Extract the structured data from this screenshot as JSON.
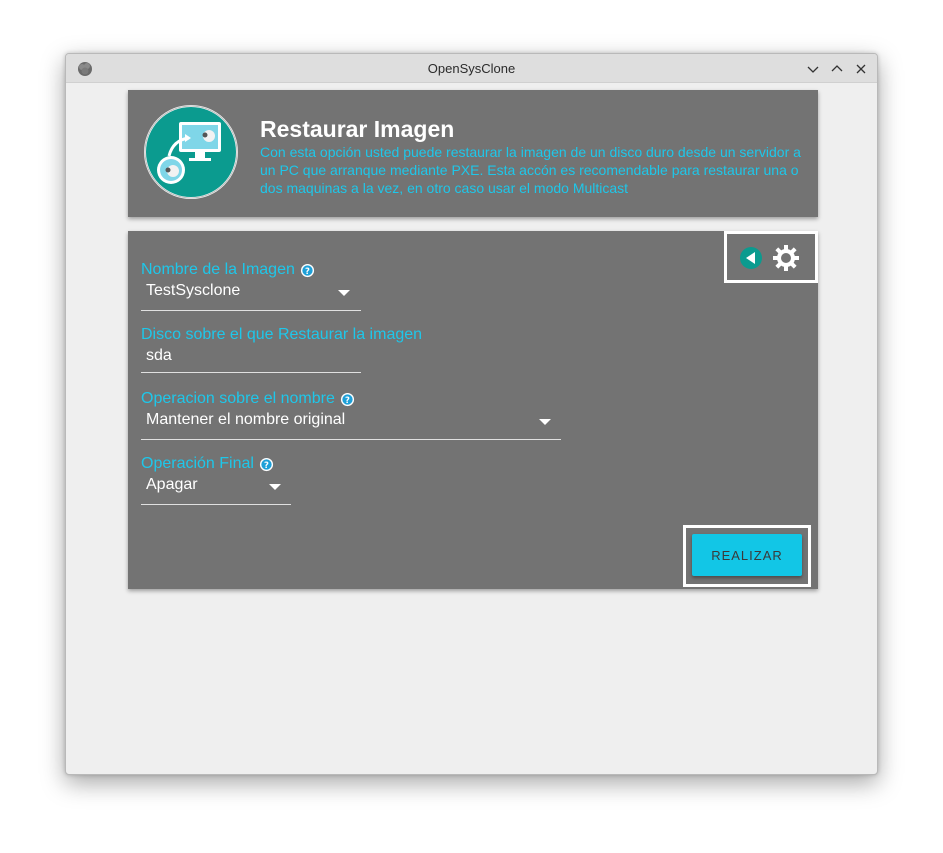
{
  "window": {
    "title": "OpenSysClone"
  },
  "header": {
    "title": "Restaurar Imagen",
    "description": "Con esta opción usted puede restaurar la imagen de un disco duro desde un servidor a un PC que arranque mediante PXE. Esta accón es recomendable para restaurar una o dos maquinas a la vez, en otro caso usar el modo Multicast"
  },
  "form": {
    "image_name": {
      "label": "Nombre de la Imagen",
      "value": "TestSysclone"
    },
    "disk": {
      "label": "Disco sobre el que Restaurar la imagen",
      "value": "sda"
    },
    "name_operation": {
      "label": "Operacion sobre el nombre",
      "value": "Mantener el nombre original"
    },
    "final_operation": {
      "label": "Operación Final",
      "value": "Apagar"
    }
  },
  "actions": {
    "submit_label": "REALIZAR"
  },
  "colors": {
    "accent": "#1ec7ea",
    "panel": "#737373",
    "button": "#12c6e6"
  }
}
